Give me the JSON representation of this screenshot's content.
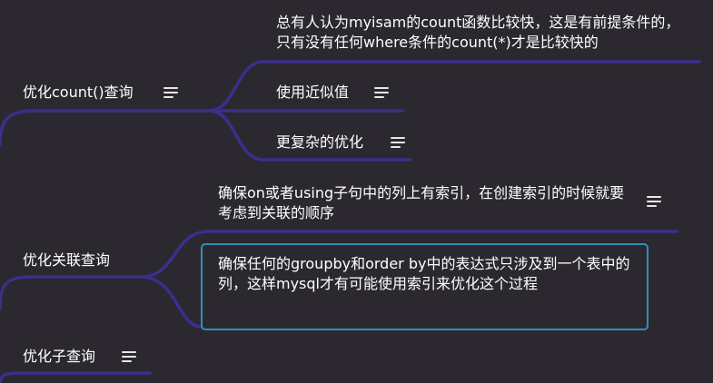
{
  "colors": {
    "background": "#2c2830",
    "branch": "#3b2f8c",
    "selection": "#2f8fb8",
    "text": "#ffffff"
  },
  "topics": [
    {
      "label": "优化count()查询",
      "icon": "notes-icon",
      "children": [
        {
          "label": "总有人认为myisam的count函数比较快，这是有前提条件的，只有没有任何where条件的count(*)才是比较快的"
        },
        {
          "label": "使用近似值",
          "icon": "notes-icon"
        },
        {
          "label": "更复杂的优化",
          "icon": "notes-icon"
        }
      ]
    },
    {
      "label": "优化关联查询",
      "children": [
        {
          "label": "确保on或者using子句中的列上有索引，在创建索引的时候就要考虑到关联的顺序",
          "icon": "notes-icon"
        },
        {
          "label": "确保任何的groupby和order by中的表达式只涉及到一个表中的列，这样mysql才有可能使用索引来优化这个过程",
          "selected": true
        }
      ]
    },
    {
      "label": "优化子查询",
      "icon": "notes-icon"
    }
  ]
}
